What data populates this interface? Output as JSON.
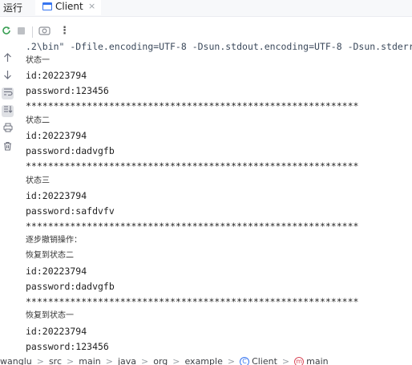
{
  "tabbar": {
    "run_label": "运行",
    "tab_label": "Client",
    "close_glyph": "×"
  },
  "toolbar": {
    "rerun_icon": "rerun-icon",
    "stop_icon": "stop-icon",
    "camera_icon": "camera-icon",
    "more_glyph": "⋮"
  },
  "gutter": {
    "icons": [
      "arrow-up-icon",
      "arrow-down-icon",
      "soft-wrap-icon",
      "scroll-to-end-icon",
      "print-icon",
      "trash-icon"
    ]
  },
  "console": {
    "lines": [
      ".2\\bin\" -Dfile.encoding=UTF-8 -Dsun.stdout.encoding=UTF-8 -Dsun.stderr",
      "状态一",
      "id:20223794",
      "password:123456",
      "************************************************************",
      "状态二",
      "id:20223794",
      "password:dadvgfb",
      "************************************************************",
      "状态三",
      "id:20223794",
      "password:safdvfv",
      "************************************************************",
      "逐步撤销操作：",
      "恢复到状态二",
      "id:20223794",
      "password:dadvgfb",
      "************************************************************",
      "恢复到状态一",
      "id:20223794",
      "password:123456"
    ]
  },
  "breadcrumb": {
    "items": [
      "wanglu",
      "src",
      "main",
      "java",
      "org",
      "example",
      "Client",
      "main"
    ],
    "separator": ">"
  },
  "colors": {
    "accent": "#3574f0",
    "run_green": "#389f53",
    "method_red": "#d94a5a"
  }
}
